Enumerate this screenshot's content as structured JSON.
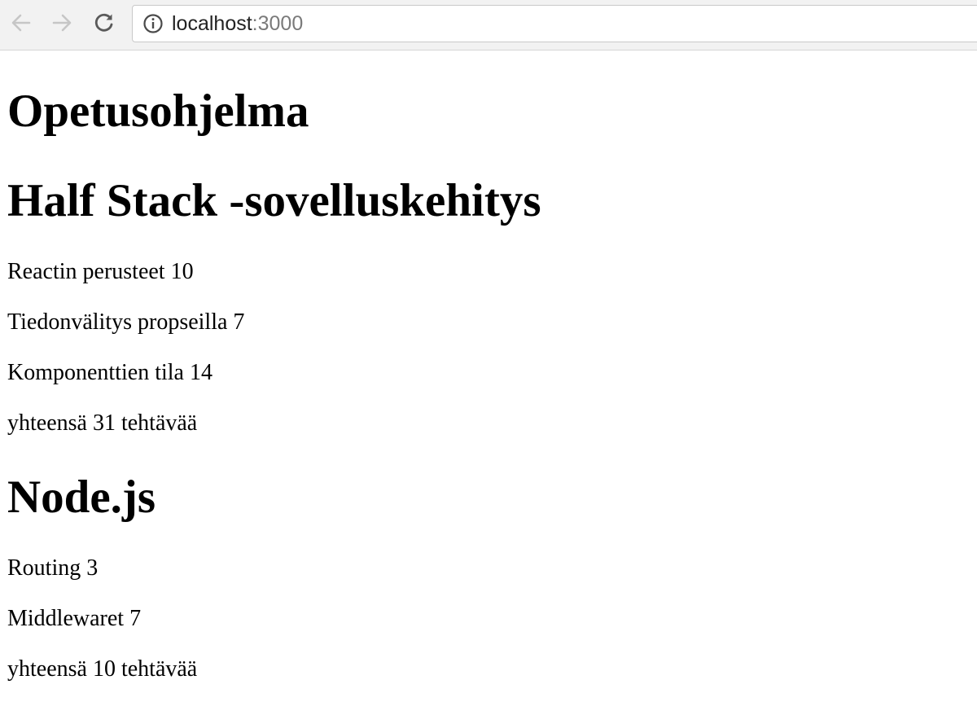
{
  "browser": {
    "url_host": "localhost",
    "url_port": ":3000",
    "icons": {
      "back": "arrow-left-icon",
      "forward": "arrow-right-icon",
      "reload": "reload-icon",
      "info": "info-circle-icon"
    }
  },
  "page": {
    "title": "Opetusohjelma",
    "courses": [
      {
        "name": "Half Stack -sovelluskehitys",
        "parts": [
          "Reactin perusteet 10",
          "Tiedonvälitys propseilla 7",
          "Komponenttien tila 14"
        ],
        "total": "yhteensä 31 tehtävää"
      },
      {
        "name": "Node.js",
        "parts": [
          "Routing 3",
          "Middlewaret 7"
        ],
        "total": "yhteensä 10 tehtävää"
      }
    ]
  }
}
